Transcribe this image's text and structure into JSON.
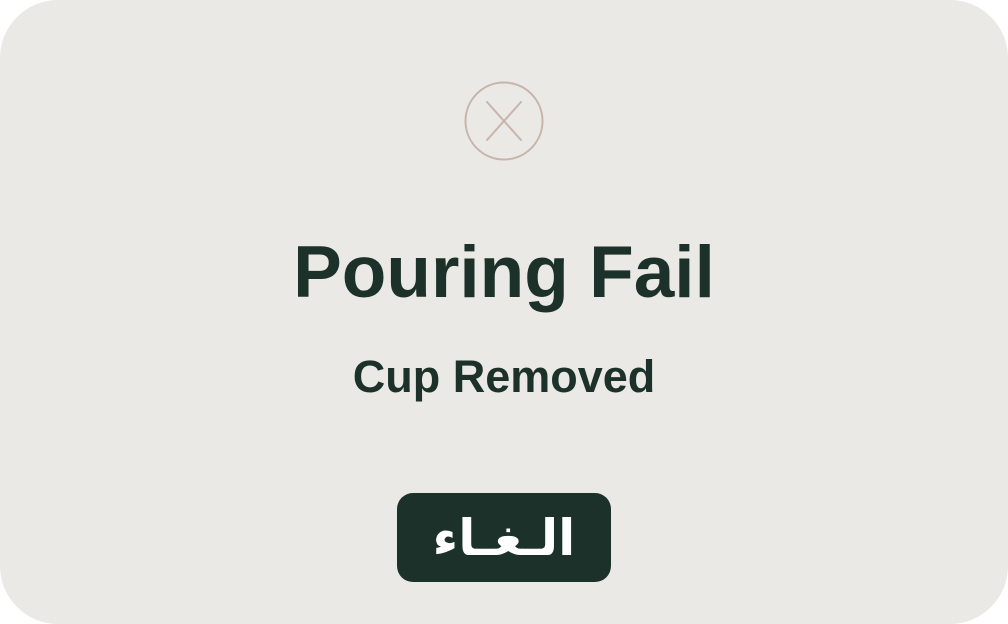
{
  "dialog": {
    "icon": "close-circle-icon",
    "title": "Pouring Fail",
    "subtitle": "Cup Removed",
    "cancel_label": "الـغـاء"
  },
  "colors": {
    "background": "#ebe9e5",
    "text": "#1c3129",
    "button": "#1b3129",
    "button_text": "#ffffff",
    "icon_stroke": "#c6b5aa"
  }
}
